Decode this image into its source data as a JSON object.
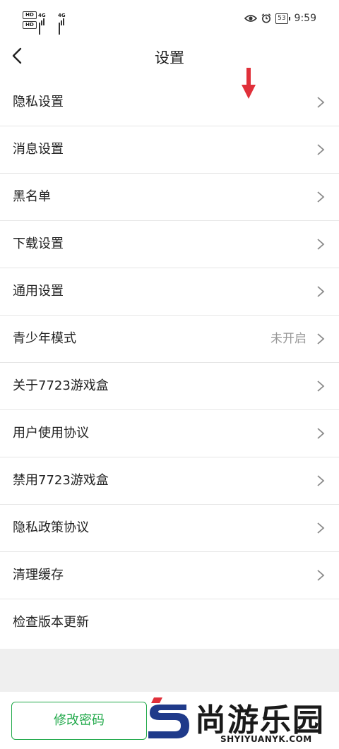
{
  "status_bar": {
    "hd1": "HD",
    "hd2": "HD",
    "net1": "4G",
    "net2": "4G",
    "battery": "53",
    "time": "9:59"
  },
  "header": {
    "title": "设置"
  },
  "menu": {
    "items": [
      {
        "label": "隐私设置",
        "value": ""
      },
      {
        "label": "消息设置",
        "value": ""
      },
      {
        "label": "黑名单",
        "value": ""
      },
      {
        "label": "下载设置",
        "value": ""
      },
      {
        "label": "通用设置",
        "value": ""
      },
      {
        "label": "青少年模式",
        "value": "未开启"
      },
      {
        "label": "关于7723游戏盒",
        "value": ""
      },
      {
        "label": "用户使用协议",
        "value": ""
      },
      {
        "label": "禁用7723游戏盒",
        "value": ""
      },
      {
        "label": "隐私政策协议",
        "value": ""
      },
      {
        "label": "清理缓存",
        "value": ""
      },
      {
        "label": "检查版本更新",
        "value": ""
      }
    ]
  },
  "bottom": {
    "change_password": "修改密码"
  },
  "watermark": {
    "name": "尚游乐园",
    "url": "SHYIYUANYK.COM"
  },
  "colors": {
    "accent": "#21a94a",
    "annotation_arrow": "#e0303a"
  },
  "icons": [
    "back-arrow",
    "chevron-right",
    "eye",
    "alarm",
    "battery"
  ]
}
